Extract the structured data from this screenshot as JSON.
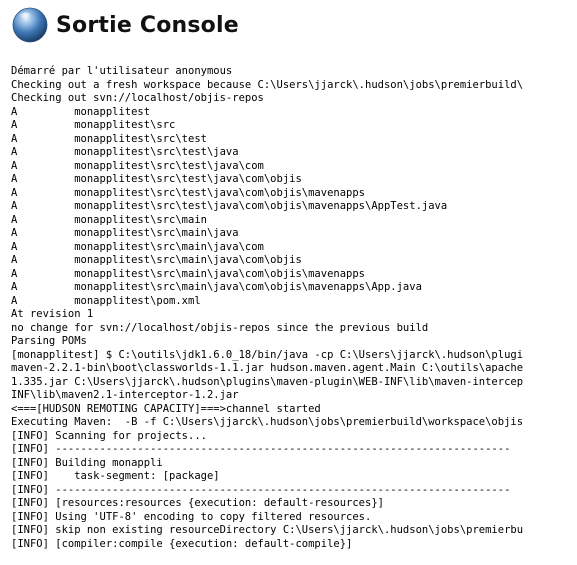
{
  "page": {
    "title": "Sortie Console",
    "icon": "console-orb-icon"
  },
  "console": {
    "lines": [
      "Démarré par l'utilisateur anonymous",
      "Checking out a fresh workspace because C:\\Users\\jjarck\\.hudson\\jobs\\premierbuild\\",
      "Checking out svn://localhost/objis-repos",
      "A         monapplitest",
      "A         monapplitest\\src",
      "A         monapplitest\\src\\test",
      "A         monapplitest\\src\\test\\java",
      "A         monapplitest\\src\\test\\java\\com",
      "A         monapplitest\\src\\test\\java\\com\\objis",
      "A         monapplitest\\src\\test\\java\\com\\objis\\mavenapps",
      "A         monapplitest\\src\\test\\java\\com\\objis\\mavenapps\\AppTest.java",
      "A         monapplitest\\src\\main",
      "A         monapplitest\\src\\main\\java",
      "A         monapplitest\\src\\main\\java\\com",
      "A         monapplitest\\src\\main\\java\\com\\objis",
      "A         monapplitest\\src\\main\\java\\com\\objis\\mavenapps",
      "A         monapplitest\\src\\main\\java\\com\\objis\\mavenapps\\App.java",
      "A         monapplitest\\pom.xml",
      "At revision 1",
      "no change for svn://localhost/objis-repos since the previous build",
      "Parsing POMs",
      "[monapplitest] $ C:\\outils\\jdk1.6.0_18/bin/java -cp C:\\Users\\jjarck\\.hudson\\plugi",
      "maven-2.2.1-bin\\boot\\classworlds-1.1.jar hudson.maven.agent.Main C:\\outils\\apache",
      "1.335.jar C:\\Users\\jjarck\\.hudson\\plugins\\maven-plugin\\WEB-INF\\lib\\maven-intercep",
      "INF\\lib\\maven2.1-interceptor-1.2.jar",
      "<===[HUDSON REMOTING CAPACITY]===>channel started",
      "Executing Maven:  -B -f C:\\Users\\jjarck\\.hudson\\jobs\\premierbuild\\workspace\\objis",
      "[INFO] Scanning for projects...",
      "[INFO] ------------------------------------------------------------------------",
      "[INFO] Building monappli",
      "[INFO]    task-segment: [package]",
      "[INFO] ------------------------------------------------------------------------",
      "[INFO] [resources:resources {execution: default-resources}]",
      "[INFO] Using 'UTF-8' encoding to copy filtered resources.",
      "[INFO] skip non existing resourceDirectory C:\\Users\\jjarck\\.hudson\\jobs\\premierbu",
      "[INFO] [compiler:compile {execution: default-compile}]"
    ]
  }
}
